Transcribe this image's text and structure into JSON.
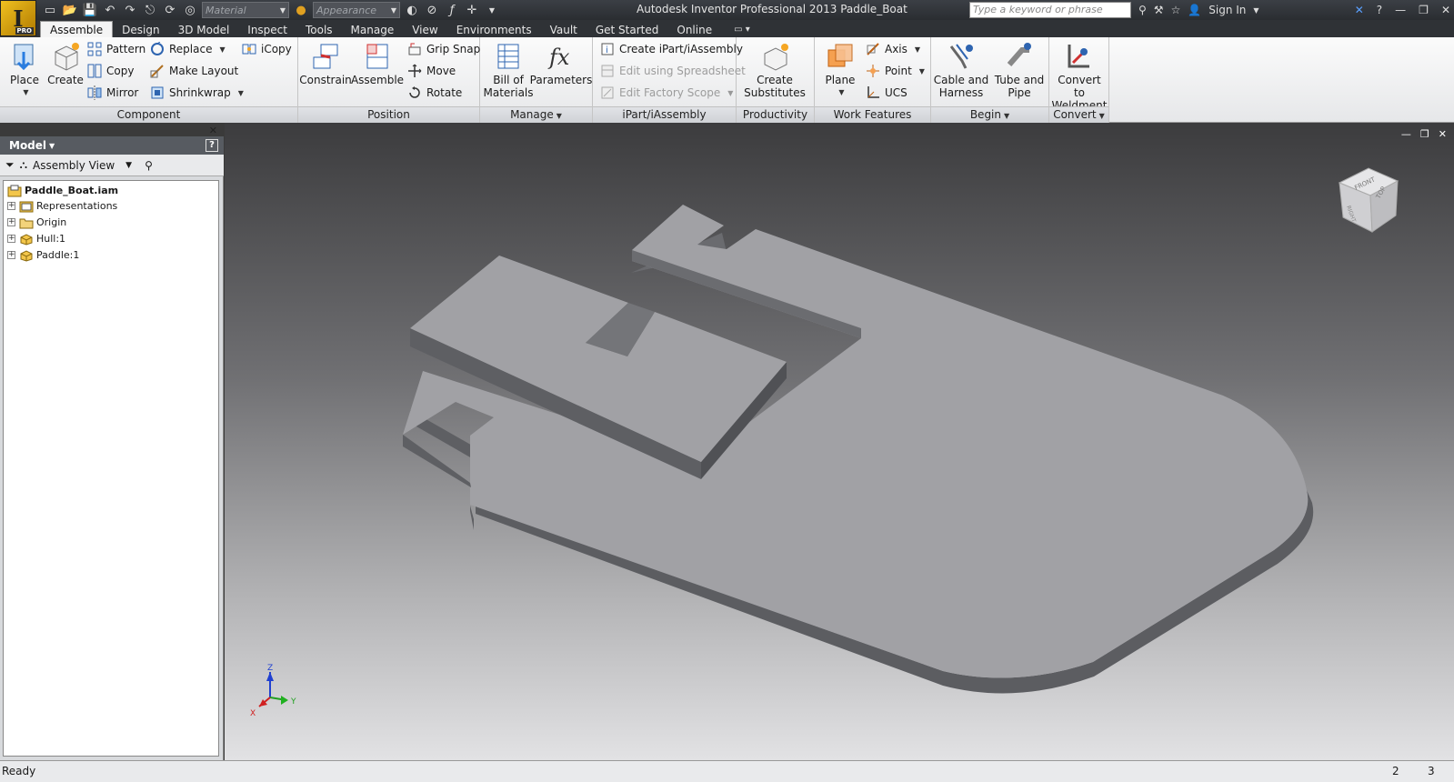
{
  "app": {
    "badge": "I",
    "badge_sub": "PRO",
    "window_title": "Autodesk Inventor Professional 2013    Paddle_Boat",
    "search_placeholder": "Type a keyword or phrase",
    "sign_in": "Sign In"
  },
  "qat": {
    "material": "Material",
    "appearance": "Appearance"
  },
  "tabs": [
    {
      "label": "Assemble",
      "active": true
    },
    {
      "label": "Design"
    },
    {
      "label": "3D Model"
    },
    {
      "label": "Inspect"
    },
    {
      "label": "Tools"
    },
    {
      "label": "Manage"
    },
    {
      "label": "View"
    },
    {
      "label": "Environments"
    },
    {
      "label": "Vault"
    },
    {
      "label": "Get Started"
    },
    {
      "label": "Online"
    }
  ],
  "ribbon": {
    "component": {
      "title": "Component",
      "place": "Place",
      "create": "Create",
      "pattern": "Pattern",
      "copy": "Copy",
      "mirror": "Mirror",
      "replace": "Replace",
      "make_layout": "Make Layout",
      "shrinkwrap": "Shrinkwrap",
      "icopy": "iCopy"
    },
    "position": {
      "title": "Position",
      "constrain": "Constrain",
      "assemble": "Assemble",
      "grip_snap": "Grip Snap",
      "move": "Move",
      "rotate": "Rotate"
    },
    "manage": {
      "title": "Manage",
      "bom_1": "Bill of",
      "bom_2": "Materials",
      "parameters": "Parameters"
    },
    "ipart": {
      "title": "iPart/iAssembly",
      "create": "Create iPart/iAssembly",
      "edit_spreadsheet": "Edit using Spreadsheet",
      "edit_factory": "Edit Factory Scope"
    },
    "productivity": {
      "title": "Productivity",
      "create_sub_1": "Create",
      "create_sub_2": "Substitutes"
    },
    "work_features": {
      "title": "Work Features",
      "plane": "Plane",
      "axis": "Axis",
      "point": "Point",
      "ucs": "UCS"
    },
    "begin": {
      "title": "Begin",
      "cable_1": "Cable and",
      "cable_2": "Harness",
      "tube_1": "Tube and",
      "tube_2": "Pipe"
    },
    "convert": {
      "title": "Convert",
      "weld_1": "Convert to",
      "weld_2": "Weldment"
    }
  },
  "browser": {
    "title": "Model",
    "help": "?",
    "view_mode": "Assembly View",
    "nodes": [
      {
        "label": "Paddle_Boat.iam",
        "root": true
      },
      {
        "label": "Representations"
      },
      {
        "label": "Origin"
      },
      {
        "label": "Hull:1"
      },
      {
        "label": "Paddle:1"
      }
    ]
  },
  "viewcube": {
    "front": "FRONT",
    "top": "TOP",
    "right": "RIGHT"
  },
  "triad": {
    "x": "X",
    "y": "Y",
    "z": "Z"
  },
  "status": {
    "text": "Ready",
    "count_1": "2",
    "count_2": "3"
  },
  "colors": {
    "model_top": "#a1a1a5",
    "model_side": "#5e5f63",
    "titlebar": "#2f3236",
    "ribbon": "#f0f0f0"
  }
}
